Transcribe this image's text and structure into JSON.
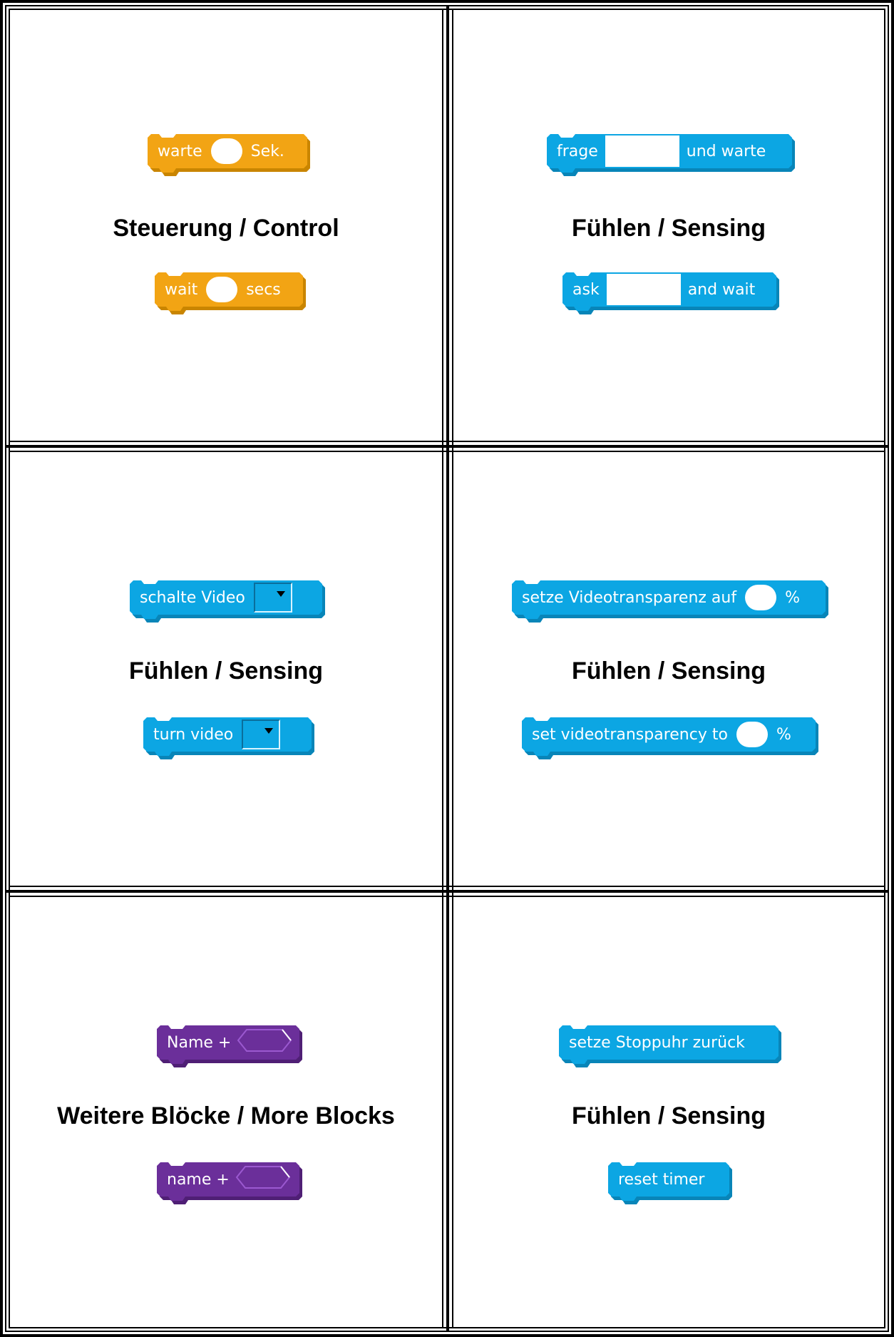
{
  "colors": {
    "control": "#f2a414",
    "control_dark": "#c98500",
    "sensing": "#0ca6e3",
    "sensing_dark": "#0885b8",
    "more_blocks": "#6b2f9a",
    "more_blocks_dark": "#4f1f75"
  },
  "cards": [
    {
      "heading": "Steuerung / Control",
      "top_block": {
        "before": "warte",
        "after": "Sek."
      },
      "bottom_block": {
        "before": "wait",
        "after": "secs"
      }
    },
    {
      "heading": "Fühlen / Sensing",
      "top_block": {
        "before": "frage",
        "after": "und warte"
      },
      "bottom_block": {
        "before": "ask",
        "after": "and wait"
      }
    },
    {
      "heading": "Fühlen / Sensing",
      "top_block": {
        "before": "schalte Video",
        "slot_icon": "dropdown-arrow-icon"
      },
      "bottom_block": {
        "before": "turn video",
        "slot_icon": "dropdown-arrow-icon"
      }
    },
    {
      "heading": "Fühlen / Sensing",
      "top_block": {
        "before": "setze Videotransparenz auf",
        "after": "%"
      },
      "bottom_block": {
        "before": "set videotransparency to",
        "after": "%"
      }
    },
    {
      "heading": "Weitere Blöcke / More Blocks",
      "top_block": {
        "before": "Name +"
      },
      "bottom_block": {
        "before": "name +"
      }
    },
    {
      "heading": "Fühlen / Sensing",
      "top_block": {
        "before": "setze Stoppuhr zurück"
      },
      "bottom_block": {
        "before": "reset timer"
      }
    }
  ]
}
